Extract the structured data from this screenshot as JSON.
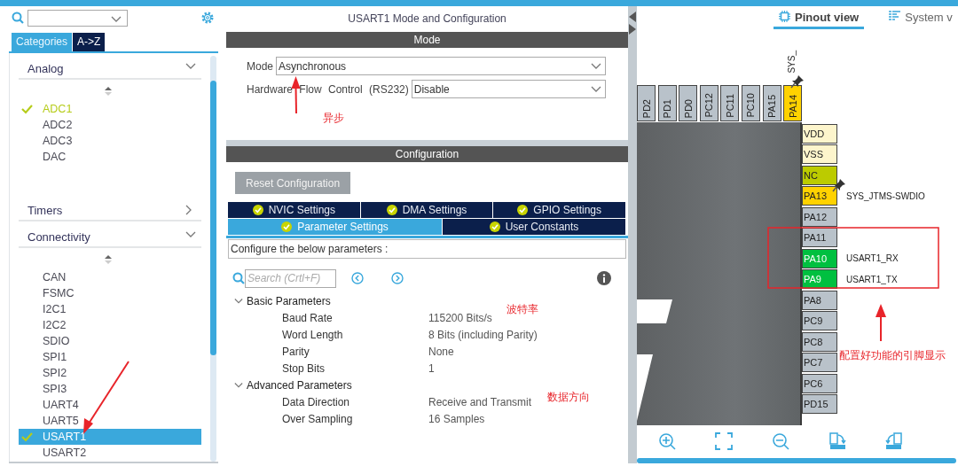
{
  "categories_panel": {
    "tabs": [
      {
        "label": "Categories",
        "selected": true
      },
      {
        "label": "A->Z",
        "selected": false
      }
    ],
    "groups": [
      {
        "label": "Analog",
        "expanded": true,
        "items": [
          {
            "label": "ADC1",
            "checked": true,
            "selected": false
          },
          {
            "label": "ADC2",
            "checked": false,
            "selected": false
          },
          {
            "label": "ADC3",
            "checked": false,
            "selected": false
          },
          {
            "label": "DAC",
            "checked": false,
            "selected": false
          }
        ]
      },
      {
        "label": "Timers",
        "expanded": false
      },
      {
        "label": "Connectivity",
        "expanded": true,
        "items": [
          {
            "label": "CAN",
            "checked": false,
            "selected": false
          },
          {
            "label": "FSMC",
            "checked": false,
            "selected": false
          },
          {
            "label": "I2C1",
            "checked": false,
            "selected": false
          },
          {
            "label": "I2C2",
            "checked": false,
            "selected": false
          },
          {
            "label": "SDIO",
            "checked": false,
            "selected": false
          },
          {
            "label": "SPI1",
            "checked": false,
            "selected": false
          },
          {
            "label": "SPI2",
            "checked": false,
            "selected": false
          },
          {
            "label": "SPI3",
            "checked": false,
            "selected": false
          },
          {
            "label": "UART4",
            "checked": false,
            "selected": false
          },
          {
            "label": "UART5",
            "checked": false,
            "selected": false
          },
          {
            "label": "USART1",
            "checked": true,
            "selected": true
          },
          {
            "label": "USART2",
            "checked": false,
            "selected": false
          }
        ]
      }
    ]
  },
  "config_panel": {
    "title": "USART1 Mode and Configuration",
    "mode_header": "Mode",
    "mode_fields": [
      {
        "label": "Mode",
        "value": "Asynchronous"
      },
      {
        "label": "Hardware Flow Control (RS232)",
        "value": "Disable"
      }
    ],
    "config_header": "Configuration",
    "reset_button": "Reset Configuration",
    "tabs": [
      [
        {
          "label": "NVIC Settings",
          "selected": false
        },
        {
          "label": "DMA Settings",
          "selected": false
        },
        {
          "label": "GPIO Settings",
          "selected": false
        }
      ],
      [
        {
          "label": "Parameter Settings",
          "selected": true
        },
        {
          "label": "User Constants",
          "selected": false
        }
      ]
    ],
    "description": "Configure the below parameters :",
    "search": {
      "placeholder": "Search (Crtl+F)"
    },
    "groups": [
      {
        "label": "Basic Parameters",
        "expanded": true,
        "params": [
          {
            "name": "Baud Rate",
            "value": "115200 Bits/s"
          },
          {
            "name": "Word Length",
            "value": "8 Bits (including Parity)"
          },
          {
            "name": "Parity",
            "value": "None"
          },
          {
            "name": "Stop Bits",
            "value": "1"
          }
        ]
      },
      {
        "label": "Advanced Parameters",
        "expanded": true,
        "params": [
          {
            "name": "Data Direction",
            "value": "Receive and Transmit"
          },
          {
            "name": "Over Sampling",
            "value": "16 Samples"
          }
        ]
      }
    ]
  },
  "pinout": {
    "tabs": [
      {
        "label": "Pinout view",
        "selected": true
      },
      {
        "label": "System v",
        "selected": false
      }
    ],
    "top_pins": [
      {
        "name": "PD2",
        "kind": "io"
      },
      {
        "name": "PD1",
        "kind": "io"
      },
      {
        "name": "PD0",
        "kind": "io"
      },
      {
        "name": "PC12",
        "kind": "io"
      },
      {
        "name": "PC11",
        "kind": "io"
      },
      {
        "name": "PC10",
        "kind": "io"
      },
      {
        "name": "PA15",
        "kind": "io"
      },
      {
        "name": "PA14",
        "kind": "system",
        "signal": "SYS_",
        "pinned": true
      }
    ],
    "right_pins": [
      {
        "name": "VDD",
        "kind": "power"
      },
      {
        "name": "VSS",
        "kind": "power"
      },
      {
        "name": "NC",
        "kind": "nc"
      },
      {
        "name": "PA13",
        "kind": "system",
        "signal": "SYS_JTMS-SWDIO",
        "pinned": true
      },
      {
        "name": "PA12",
        "kind": "io"
      },
      {
        "name": "PA11",
        "kind": "io"
      },
      {
        "name": "PA10",
        "kind": "assigned",
        "signal": "USART1_RX"
      },
      {
        "name": "PA9",
        "kind": "assigned",
        "signal": "USART1_TX"
      },
      {
        "name": "PA8",
        "kind": "io"
      },
      {
        "name": "PC9",
        "kind": "io"
      },
      {
        "name": "PC8",
        "kind": "io"
      },
      {
        "name": "PC7",
        "kind": "io"
      },
      {
        "name": "PC6",
        "kind": "io"
      },
      {
        "name": "PD15",
        "kind": "io"
      }
    ]
  },
  "annotations": [
    {
      "text": "异步"
    },
    {
      "text": "波特率"
    },
    {
      "text": "数据方向"
    },
    {
      "text": "配置好功能的引脚显示"
    }
  ]
}
